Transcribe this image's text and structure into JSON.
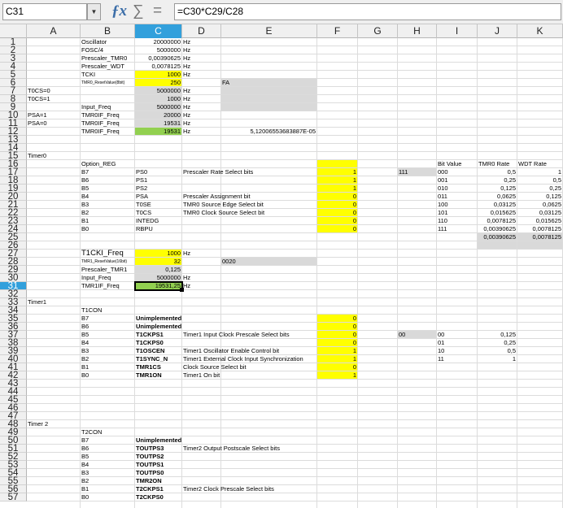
{
  "formula_bar": {
    "cell_ref": "C31",
    "formula": "=C30*C29/C28",
    "fx_icon": "ƒx",
    "sum_icon": "∑",
    "equals_icon": "="
  },
  "selected": {
    "col": "C",
    "row": 31
  },
  "columns": [
    "A",
    "B",
    "C",
    "D",
    "E",
    "F",
    "G",
    "H",
    "I",
    "J",
    "K"
  ],
  "first_row": 1,
  "visible_rows": 57,
  "fills": [
    {
      "c": "C",
      "r": 5,
      "k": "y"
    },
    {
      "c": "C",
      "r": 6,
      "k": "y"
    },
    {
      "c": "C",
      "r": 7,
      "k": "g"
    },
    {
      "c": "C",
      "r": 8,
      "k": "g"
    },
    {
      "c": "C",
      "r": 9,
      "k": "g"
    },
    {
      "c": "C",
      "r": 10,
      "k": "g"
    },
    {
      "c": "C",
      "r": 11,
      "k": "g"
    },
    {
      "c": "C",
      "r": 12,
      "k": "gr"
    },
    {
      "c": "E",
      "r": 6,
      "k": "g"
    },
    {
      "c": "E",
      "r": 7,
      "k": "g"
    },
    {
      "c": "E",
      "r": 8,
      "k": "g"
    },
    {
      "c": "E",
      "r": 9,
      "k": "g"
    },
    {
      "c": "F",
      "r": 16,
      "k": "y"
    },
    {
      "c": "F",
      "r": 17,
      "k": "y"
    },
    {
      "c": "F",
      "r": 18,
      "k": "y"
    },
    {
      "c": "F",
      "r": 19,
      "k": "y"
    },
    {
      "c": "F",
      "r": 20,
      "k": "y"
    },
    {
      "c": "F",
      "r": 21,
      "k": "y"
    },
    {
      "c": "F",
      "r": 22,
      "k": "y"
    },
    {
      "c": "F",
      "r": 23,
      "k": "y"
    },
    {
      "c": "F",
      "r": 24,
      "k": "y"
    },
    {
      "c": "H",
      "r": 17,
      "k": "g"
    },
    {
      "c": "J",
      "r": 25,
      "k": "g"
    },
    {
      "c": "K",
      "r": 25,
      "k": "g"
    },
    {
      "c": "J",
      "r": 26,
      "k": "g"
    },
    {
      "c": "K",
      "r": 26,
      "k": "g"
    },
    {
      "c": "C",
      "r": 27,
      "k": "y"
    },
    {
      "c": "C",
      "r": 28,
      "k": "y"
    },
    {
      "c": "C",
      "r": 29,
      "k": "g"
    },
    {
      "c": "C",
      "r": 30,
      "k": "g"
    },
    {
      "c": "C",
      "r": 31,
      "k": "gr"
    },
    {
      "c": "E",
      "r": 28,
      "k": "g"
    },
    {
      "c": "F",
      "r": 35,
      "k": "y"
    },
    {
      "c": "F",
      "r": 36,
      "k": "y"
    },
    {
      "c": "F",
      "r": 37,
      "k": "y"
    },
    {
      "c": "F",
      "r": 38,
      "k": "y"
    },
    {
      "c": "F",
      "r": 39,
      "k": "y"
    },
    {
      "c": "F",
      "r": 40,
      "k": "y"
    },
    {
      "c": "F",
      "r": 41,
      "k": "y"
    },
    {
      "c": "F",
      "r": 42,
      "k": "y"
    },
    {
      "c": "H",
      "r": 37,
      "k": "g"
    }
  ],
  "cells": [
    {
      "c": "B",
      "r": 1,
      "v": "Oscillator"
    },
    {
      "c": "C",
      "r": 1,
      "v": "20000000",
      "a": "r"
    },
    {
      "c": "D",
      "r": 1,
      "v": "Hz"
    },
    {
      "c": "B",
      "r": 2,
      "v": "FOSC/4"
    },
    {
      "c": "C",
      "r": 2,
      "v": "5000000",
      "a": "r"
    },
    {
      "c": "D",
      "r": 2,
      "v": "Hz"
    },
    {
      "c": "B",
      "r": 3,
      "v": "Prescaler_TMR0"
    },
    {
      "c": "C",
      "r": 3,
      "v": "0,00390625",
      "a": "r"
    },
    {
      "c": "D",
      "r": 3,
      "v": "Hz"
    },
    {
      "c": "B",
      "r": 4,
      "v": "Prescaler_WDT"
    },
    {
      "c": "C",
      "r": 4,
      "v": "0,0078125",
      "a": "r"
    },
    {
      "c": "D",
      "r": 4,
      "v": "Hz"
    },
    {
      "c": "B",
      "r": 5,
      "v": "TCKI"
    },
    {
      "c": "C",
      "r": 5,
      "v": "1000",
      "a": "r"
    },
    {
      "c": "D",
      "r": 5,
      "v": "Hz"
    },
    {
      "c": "B",
      "r": 6,
      "v": "TMR0_ResetValue(8bit)",
      "s": "sm"
    },
    {
      "c": "C",
      "r": 6,
      "v": "250",
      "a": "r"
    },
    {
      "c": "E",
      "r": 6,
      "v": "FA"
    },
    {
      "c": "A",
      "r": 7,
      "v": "T0CS=0"
    },
    {
      "c": "C",
      "r": 7,
      "v": "5000000",
      "a": "r"
    },
    {
      "c": "D",
      "r": 7,
      "v": "Hz"
    },
    {
      "c": "A",
      "r": 8,
      "v": "T0CS=1"
    },
    {
      "c": "C",
      "r": 8,
      "v": "1000",
      "a": "r"
    },
    {
      "c": "D",
      "r": 8,
      "v": "Hz"
    },
    {
      "c": "B",
      "r": 9,
      "v": "Input_Freq"
    },
    {
      "c": "C",
      "r": 9,
      "v": "5000000",
      "a": "r"
    },
    {
      "c": "D",
      "r": 9,
      "v": "Hz"
    },
    {
      "c": "A",
      "r": 10,
      "v": "PSA=1"
    },
    {
      "c": "B",
      "r": 10,
      "v": "TMR0IF_Freq"
    },
    {
      "c": "C",
      "r": 10,
      "v": "20000",
      "a": "r"
    },
    {
      "c": "D",
      "r": 10,
      "v": "Hz"
    },
    {
      "c": "A",
      "r": 11,
      "v": "PSA=0"
    },
    {
      "c": "B",
      "r": 11,
      "v": "TMR0IF_Freq"
    },
    {
      "c": "C",
      "r": 11,
      "v": "19531",
      "a": "r"
    },
    {
      "c": "D",
      "r": 11,
      "v": "Hz"
    },
    {
      "c": "B",
      "r": 12,
      "v": "TMR0IF_Freq"
    },
    {
      "c": "C",
      "r": 12,
      "v": "19531",
      "a": "r"
    },
    {
      "c": "D",
      "r": 12,
      "v": "Hz"
    },
    {
      "c": "E",
      "r": 12,
      "v": "5,12006553683887E-05",
      "a": "r",
      "span": 1
    },
    {
      "c": "A",
      "r": 15,
      "v": "Timer0"
    },
    {
      "c": "B",
      "r": 16,
      "v": "Option_REG"
    },
    {
      "c": "I",
      "r": 16,
      "v": "Bit Value"
    },
    {
      "c": "J",
      "r": 16,
      "v": "TMR0 Rate"
    },
    {
      "c": "K",
      "r": 16,
      "v": "WDT Rate"
    },
    {
      "c": "B",
      "r": 17,
      "v": "B7"
    },
    {
      "c": "C",
      "r": 17,
      "v": "PS0"
    },
    {
      "c": "D",
      "r": 17,
      "v": "Prescaler Rate Select bits"
    },
    {
      "c": "F",
      "r": 17,
      "v": "1",
      "a": "r"
    },
    {
      "c": "H",
      "r": 17,
      "v": "111"
    },
    {
      "c": "I",
      "r": 17,
      "v": "000"
    },
    {
      "c": "J",
      "r": 17,
      "v": "0,5",
      "a": "r"
    },
    {
      "c": "K",
      "r": 17,
      "v": "1",
      "a": "r"
    },
    {
      "c": "B",
      "r": 18,
      "v": "B6"
    },
    {
      "c": "C",
      "r": 18,
      "v": "PS1"
    },
    {
      "c": "F",
      "r": 18,
      "v": "1",
      "a": "r"
    },
    {
      "c": "I",
      "r": 18,
      "v": "001"
    },
    {
      "c": "J",
      "r": 18,
      "v": "0,25",
      "a": "r"
    },
    {
      "c": "K",
      "r": 18,
      "v": "0,5",
      "a": "r"
    },
    {
      "c": "B",
      "r": 19,
      "v": "B5"
    },
    {
      "c": "C",
      "r": 19,
      "v": "PS2"
    },
    {
      "c": "F",
      "r": 19,
      "v": "1",
      "a": "r"
    },
    {
      "c": "I",
      "r": 19,
      "v": "010"
    },
    {
      "c": "J",
      "r": 19,
      "v": "0,125",
      "a": "r"
    },
    {
      "c": "K",
      "r": 19,
      "v": "0,25",
      "a": "r"
    },
    {
      "c": "B",
      "r": 20,
      "v": "B4"
    },
    {
      "c": "C",
      "r": 20,
      "v": "PSA"
    },
    {
      "c": "D",
      "r": 20,
      "v": "Prescaler Assignment bit"
    },
    {
      "c": "F",
      "r": 20,
      "v": "0",
      "a": "r"
    },
    {
      "c": "I",
      "r": 20,
      "v": "011"
    },
    {
      "c": "J",
      "r": 20,
      "v": "0,0625",
      "a": "r"
    },
    {
      "c": "K",
      "r": 20,
      "v": "0,125",
      "a": "r"
    },
    {
      "c": "B",
      "r": 21,
      "v": "B3"
    },
    {
      "c": "C",
      "r": 21,
      "v": "T0SE"
    },
    {
      "c": "D",
      "r": 21,
      "v": "TMR0 Source Edge Select bit"
    },
    {
      "c": "F",
      "r": 21,
      "v": "0",
      "a": "r"
    },
    {
      "c": "I",
      "r": 21,
      "v": "100"
    },
    {
      "c": "J",
      "r": 21,
      "v": "0,03125",
      "a": "r"
    },
    {
      "c": "K",
      "r": 21,
      "v": "0,0625",
      "a": "r"
    },
    {
      "c": "B",
      "r": 22,
      "v": "B2"
    },
    {
      "c": "C",
      "r": 22,
      "v": "T0CS"
    },
    {
      "c": "D",
      "r": 22,
      "v": "TMR0 Clock Source Select bit"
    },
    {
      "c": "F",
      "r": 22,
      "v": "0",
      "a": "r"
    },
    {
      "c": "I",
      "r": 22,
      "v": "101"
    },
    {
      "c": "J",
      "r": 22,
      "v": "0,015625",
      "a": "r"
    },
    {
      "c": "K",
      "r": 22,
      "v": "0,03125",
      "a": "r"
    },
    {
      "c": "B",
      "r": 23,
      "v": "B1"
    },
    {
      "c": "C",
      "r": 23,
      "v": "INTEDG"
    },
    {
      "c": "F",
      "r": 23,
      "v": "0",
      "a": "r"
    },
    {
      "c": "I",
      "r": 23,
      "v": "110"
    },
    {
      "c": "J",
      "r": 23,
      "v": "0,0078125",
      "a": "r"
    },
    {
      "c": "K",
      "r": 23,
      "v": "0,015625",
      "a": "r"
    },
    {
      "c": "B",
      "r": 24,
      "v": "B0"
    },
    {
      "c": "C",
      "r": 24,
      "v": "RBPU"
    },
    {
      "c": "F",
      "r": 24,
      "v": "0",
      "a": "r"
    },
    {
      "c": "I",
      "r": 24,
      "v": "111"
    },
    {
      "c": "J",
      "r": 24,
      "v": "0,00390625",
      "a": "r"
    },
    {
      "c": "K",
      "r": 24,
      "v": "0,0078125",
      "a": "r"
    },
    {
      "c": "J",
      "r": 25,
      "v": "0,00390625",
      "a": "r"
    },
    {
      "c": "K",
      "r": 25,
      "v": "0,0078125",
      "a": "r"
    },
    {
      "c": "B",
      "r": 27,
      "v": "T1CKI_Freq",
      "s": "lg"
    },
    {
      "c": "C",
      "r": 27,
      "v": "1000",
      "a": "r"
    },
    {
      "c": "D",
      "r": 27,
      "v": "Hz"
    },
    {
      "c": "B",
      "r": 28,
      "v": "TMR1_ResetValue(16bit)",
      "s": "sm"
    },
    {
      "c": "C",
      "r": 28,
      "v": "32",
      "a": "r"
    },
    {
      "c": "E",
      "r": 28,
      "v": "0020"
    },
    {
      "c": "B",
      "r": 29,
      "v": "Prescaler_TMR1"
    },
    {
      "c": "C",
      "r": 29,
      "v": "0,125",
      "a": "r"
    },
    {
      "c": "B",
      "r": 30,
      "v": "Input_Freq"
    },
    {
      "c": "C",
      "r": 30,
      "v": "5000000",
      "a": "r"
    },
    {
      "c": "D",
      "r": 30,
      "v": "Hz"
    },
    {
      "c": "B",
      "r": 31,
      "v": "TMR1IF_Freq"
    },
    {
      "c": "C",
      "r": 31,
      "v": "19531,25",
      "a": "r"
    },
    {
      "c": "D",
      "r": 31,
      "v": "Hz"
    },
    {
      "c": "A",
      "r": 33,
      "v": "Timer1"
    },
    {
      "c": "B",
      "r": 34,
      "v": "T1CON"
    },
    {
      "c": "B",
      "r": 35,
      "v": "B7"
    },
    {
      "c": "C",
      "r": 35,
      "v": "Unimplemented",
      "b": 1
    },
    {
      "c": "F",
      "r": 35,
      "v": "0",
      "a": "r"
    },
    {
      "c": "B",
      "r": 36,
      "v": "B6"
    },
    {
      "c": "C",
      "r": 36,
      "v": "Unimplemented",
      "b": 1
    },
    {
      "c": "F",
      "r": 36,
      "v": "0",
      "a": "r"
    },
    {
      "c": "B",
      "r": 37,
      "v": "B5"
    },
    {
      "c": "C",
      "r": 37,
      "v": "T1CKPS1",
      "b": 1
    },
    {
      "c": "D",
      "r": 37,
      "v": "Timer1 Input Clock Prescale Select bits"
    },
    {
      "c": "F",
      "r": 37,
      "v": "0",
      "a": "r"
    },
    {
      "c": "H",
      "r": 37,
      "v": "00"
    },
    {
      "c": "I",
      "r": 37,
      "v": "00"
    },
    {
      "c": "J",
      "r": 37,
      "v": "0,125",
      "a": "r"
    },
    {
      "c": "B",
      "r": 38,
      "v": "B4"
    },
    {
      "c": "C",
      "r": 38,
      "v": "T1CKPS0",
      "b": 1
    },
    {
      "c": "F",
      "r": 38,
      "v": "0",
      "a": "r"
    },
    {
      "c": "I",
      "r": 38,
      "v": "01"
    },
    {
      "c": "J",
      "r": 38,
      "v": "0,25",
      "a": "r"
    },
    {
      "c": "B",
      "r": 39,
      "v": "B3"
    },
    {
      "c": "C",
      "r": 39,
      "v": "T1OSCEN",
      "b": 1
    },
    {
      "c": "D",
      "r": 39,
      "v": "Timer1 Oscillator Enable Control bit"
    },
    {
      "c": "F",
      "r": 39,
      "v": "1",
      "a": "r"
    },
    {
      "c": "I",
      "r": 39,
      "v": "10"
    },
    {
      "c": "J",
      "r": 39,
      "v": "0,5",
      "a": "r"
    },
    {
      "c": "B",
      "r": 40,
      "v": "B2"
    },
    {
      "c": "C",
      "r": 40,
      "v": "T1SYNC_N",
      "b": 1
    },
    {
      "c": "D",
      "r": 40,
      "v": "Timer1 External Clock Input Synchronization"
    },
    {
      "c": "F",
      "r": 40,
      "v": "1",
      "a": "r"
    },
    {
      "c": "I",
      "r": 40,
      "v": "11"
    },
    {
      "c": "J",
      "r": 40,
      "v": "1",
      "a": "r"
    },
    {
      "c": "B",
      "r": 41,
      "v": "B1"
    },
    {
      "c": "C",
      "r": 41,
      "v": "TMR1CS",
      "b": 1
    },
    {
      "c": "D",
      "r": 41,
      "v": "Clock Source Select bit"
    },
    {
      "c": "F",
      "r": 41,
      "v": "0",
      "a": "r"
    },
    {
      "c": "B",
      "r": 42,
      "v": "B0"
    },
    {
      "c": "C",
      "r": 42,
      "v": "TMR1ON",
      "b": 1
    },
    {
      "c": "D",
      "r": 42,
      "v": "Timer1 On bit"
    },
    {
      "c": "F",
      "r": 42,
      "v": "1",
      "a": "r"
    },
    {
      "c": "A",
      "r": 48,
      "v": "Timer 2"
    },
    {
      "c": "B",
      "r": 49,
      "v": "T2CON"
    },
    {
      "c": "B",
      "r": 50,
      "v": "B7"
    },
    {
      "c": "C",
      "r": 50,
      "v": "Unimplemented",
      "b": 1
    },
    {
      "c": "B",
      "r": 51,
      "v": "B6"
    },
    {
      "c": "C",
      "r": 51,
      "v": "TOUTPS3",
      "b": 1
    },
    {
      "c": "D",
      "r": 51,
      "v": "Timer2 Output Postscale Select bits"
    },
    {
      "c": "B",
      "r": 52,
      "v": "B5"
    },
    {
      "c": "C",
      "r": 52,
      "v": "TOUTPS2",
      "b": 1
    },
    {
      "c": "B",
      "r": 53,
      "v": "B4"
    },
    {
      "c": "C",
      "r": 53,
      "v": "TOUTPS1",
      "b": 1
    },
    {
      "c": "B",
      "r": 54,
      "v": "B3"
    },
    {
      "c": "C",
      "r": 54,
      "v": "TOUTPS0",
      "b": 1
    },
    {
      "c": "B",
      "r": 55,
      "v": "B2"
    },
    {
      "c": "C",
      "r": 55,
      "v": "TMR2ON",
      "b": 1
    },
    {
      "c": "B",
      "r": 56,
      "v": "B1"
    },
    {
      "c": "C",
      "r": 56,
      "v": "T2CKPS1",
      "b": 1
    },
    {
      "c": "D",
      "r": 56,
      "v": "Timer2 Clock Prescale Select bits"
    },
    {
      "c": "B",
      "r": 57,
      "v": "B0"
    },
    {
      "c": "C",
      "r": 57,
      "v": "T2CKPS0",
      "b": 1
    }
  ]
}
